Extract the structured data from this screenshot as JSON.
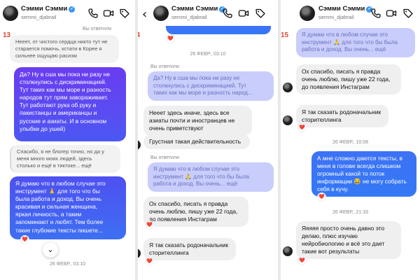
{
  "contact": {
    "name": "Сэмми Сэмми",
    "username": "semmi_djabrail"
  },
  "icons": [
    "back-arrow-icon",
    "verified-icon",
    "phone-icon",
    "video-icon",
    "tag-icon",
    "heart-icon",
    "chevron-down-icon"
  ],
  "colors": {
    "accent": "#3897f0",
    "incoming": "#efefef",
    "outgoing_start": "#6a3cf0",
    "outgoing_end": "#3478f6",
    "page_number": "#e0452e",
    "heart": "#e0245e"
  },
  "panel1": {
    "page_number": "13",
    "replied_label": "Вы ответили",
    "messages": [
      "Нееет, от чистого сердца никто тут не старается помочь, кстати в Корее я сильнее ощущаю расизм",
      "Да? Ну в сша мы пока ни разу не\nстолкнулись с дискриминацией.\nТут таких как мы море и разность\nнародов тут прям завораживает.\nТут работают рука об руку и\nпакистанцы и американцы и\nрусские и азиаты. И в основном\nулыбки до ушей)",
      "Спасибо, я не блогер точно, но да у\nменя много моих людей, здесь\nстолько и ещё в тиктоке... ещё",
      "Я думаю что в любом случае это\nинструмент 🙏 для того что бы\nбыла работа и доход. Вы очень\nкрасивая и сильная женщина,\nяркая личность, а таким\nзапоминают и любят. Тем более\nтакие глубокие тексты пишете..."
    ],
    "heart": "❤️",
    "timestamp": "26 ФЕВР., 03:10"
  },
  "panel2": {
    "page_number": "14",
    "timestamp1": "26 ФЕВР., 03:10",
    "replied_label1": "Вы ответили",
    "quote1": "Да? Ну в сша мы пока ни разу не\nстолкнулись с дискриминацией. Тут\nтаких как мы море и разность народ...",
    "messages": [
      "Нееет здесь иначе, здесь все\nазиаты почти и иностранцев не\nочень приветствуют",
      "Грустная такая действительность",
      "Ох спасибо, писать я правда\nочень люблю, пишу уже 22 года,\nдо появления Инстаграм",
      "Я так сказать родоначальник\nсторителлинга"
    ],
    "replied_label2": "Вы ответили",
    "quote2": "Я думаю что в любом случае это\nинструмент 🙏 для того что бы была\nработа и доход. Вы очень... ещё",
    "heart": "❤️"
  },
  "panel3": {
    "page_number": "15",
    "quote": "Я думаю что в любом случае это\nинструмент 🙏 для того что бы была\nработа и доход. Вы очень... ещё",
    "messages_in1": [
      "Ох спасибо, писать я правда\nочень люблю, пишу уже 22 года,\nдо появления Инстаграм",
      "Я так сказать родоначальник\nсторителлинга"
    ],
    "timestamp1": "26 ФЕВР., 10:08",
    "message_out": "А мне сложно даются тексты, в\nменя в голове всегда слишком\nогромный какой то поток\nинформации 😂 не могу собрать\nсебя в кучу.",
    "timestamp2": "26 ФЕВР., 21:33",
    "message_in2": "Яяяяя просто очень давно это\nделаю, плюс изучаю\nнейробиологию и всё это дает\nтакие вот результаты",
    "heart": "❤️"
  }
}
